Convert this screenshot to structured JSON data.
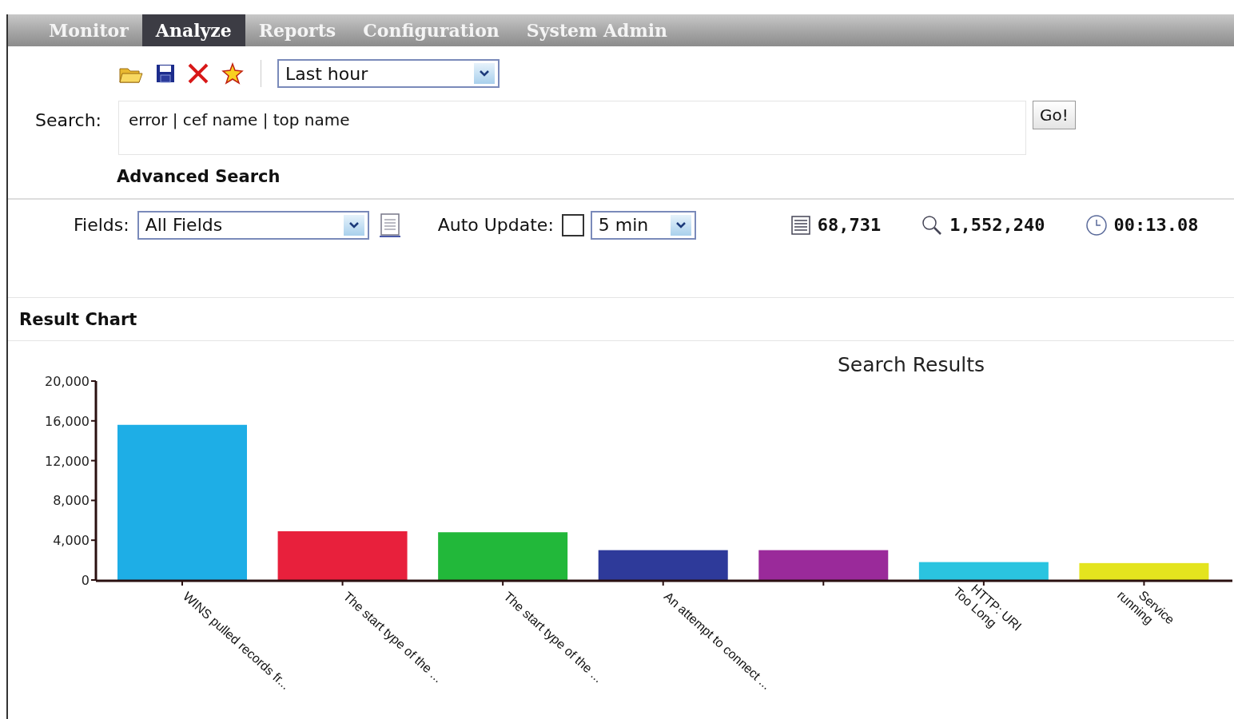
{
  "nav": {
    "tabs": [
      {
        "label": "Monitor",
        "selected": false
      },
      {
        "label": "Analyze",
        "selected": true
      },
      {
        "label": "Reports",
        "selected": false
      },
      {
        "label": "Configuration",
        "selected": false
      },
      {
        "label": "System Admin",
        "selected": false
      }
    ]
  },
  "toolbar": {
    "time_range": "Last hour"
  },
  "search": {
    "label": "Search:",
    "value": "error | cef name | top name",
    "button": "Go!",
    "advanced_link": "Advanced Search"
  },
  "filters": {
    "fields_label": "Fields:",
    "fields_value": "All Fields",
    "auto_update_label": "Auto Update:",
    "auto_update_checked": false,
    "interval": "5 min"
  },
  "stats": [
    {
      "kind": "events",
      "value": "68,731"
    },
    {
      "kind": "scanned",
      "value": "1,552,240"
    },
    {
      "kind": "time",
      "value": "00:13.08"
    }
  ],
  "result_chart": {
    "heading": "Result Chart",
    "chart_data": {
      "type": "bar",
      "title": "Search Results",
      "categories": [
        "WINS pulled records fr...",
        "The start type of the ...",
        "The start type of the ...",
        "An attempt to connect ...",
        null,
        "HTTP: URI Too Long",
        "Service running"
      ],
      "stacked": true,
      "series": [
        {
          "color": "#1eaee6",
          "values": [
            15600,
            null,
            null,
            null,
            null,
            null,
            null
          ]
        },
        {
          "color": "#e8203c",
          "values": [
            null,
            4900,
            null,
            null,
            null,
            null,
            null
          ]
        },
        {
          "color": "#22b83a",
          "values": [
            null,
            null,
            4800,
            null,
            null,
            null,
            null
          ]
        },
        {
          "color": "#2e3a9a",
          "values": [
            null,
            null,
            null,
            3000,
            null,
            null,
            null
          ]
        },
        {
          "color": "#9a2a9a",
          "values": [
            null,
            null,
            null,
            null,
            3000,
            null,
            null
          ]
        },
        {
          "color": "#2ac4e0",
          "values": [
            null,
            null,
            null,
            null,
            null,
            1800,
            null
          ]
        },
        {
          "color": "#e4e41e",
          "values": [
            null,
            null,
            null,
            null,
            null,
            null,
            1700
          ]
        }
      ],
      "ylim": [
        0,
        20000
      ],
      "yticks": [
        {
          "value": 0,
          "label": "0"
        },
        {
          "value": 4000,
          "label": "4,000"
        },
        {
          "value": 8000,
          "label": "8,000"
        },
        {
          "value": 12000,
          "label": "12,000"
        },
        {
          "value": 16000,
          "label": "16,000"
        },
        {
          "value": 20000,
          "label": "20,000"
        }
      ]
    }
  }
}
